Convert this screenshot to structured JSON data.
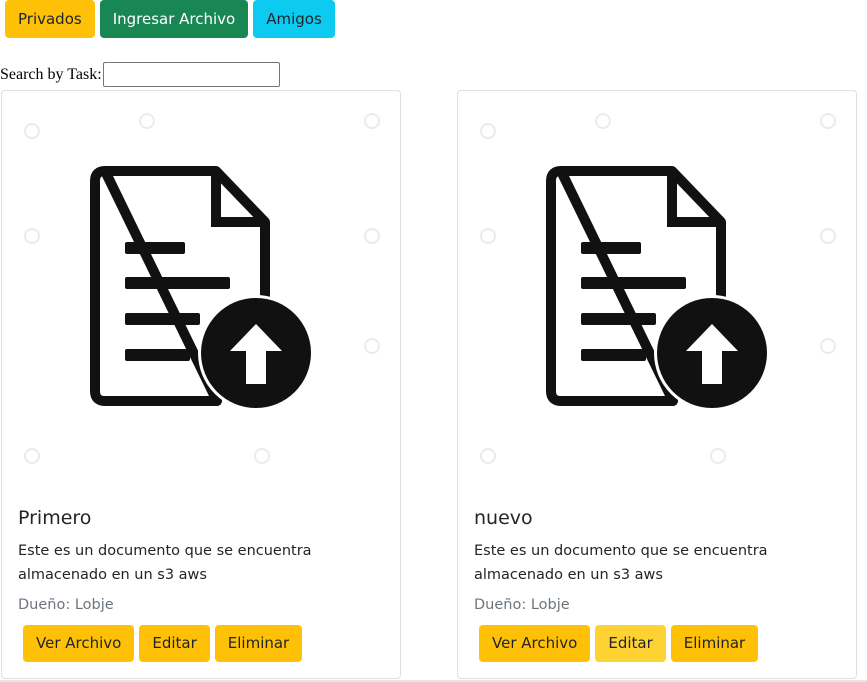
{
  "nav": {
    "privados_label": "Privados",
    "ingresar_label": "Ingresar Archivo",
    "amigos_label": "Amigos"
  },
  "search": {
    "label": "Search by Task:",
    "value": ""
  },
  "cards": [
    {
      "title": "Primero",
      "text": "Este es un documento que se encuentra almacenado en un s3 aws",
      "owner": "Dueño: Lobje",
      "view_label": "Ver Archivo",
      "edit_label": "Editar",
      "delete_label": "Eliminar",
      "image_icon": "document-upload-icon"
    },
    {
      "title": "nuevo",
      "text": "Este es un documento que se encuentra almacenado en un s3 aws",
      "owner": "Dueño: Lobje",
      "view_label": "Ver Archivo",
      "edit_label": "Editar",
      "delete_label": "Eliminar",
      "image_icon": "document-upload-icon"
    }
  ],
  "colors": {
    "warning": "#ffc107",
    "success": "#198754",
    "info": "#0dcaf0"
  }
}
